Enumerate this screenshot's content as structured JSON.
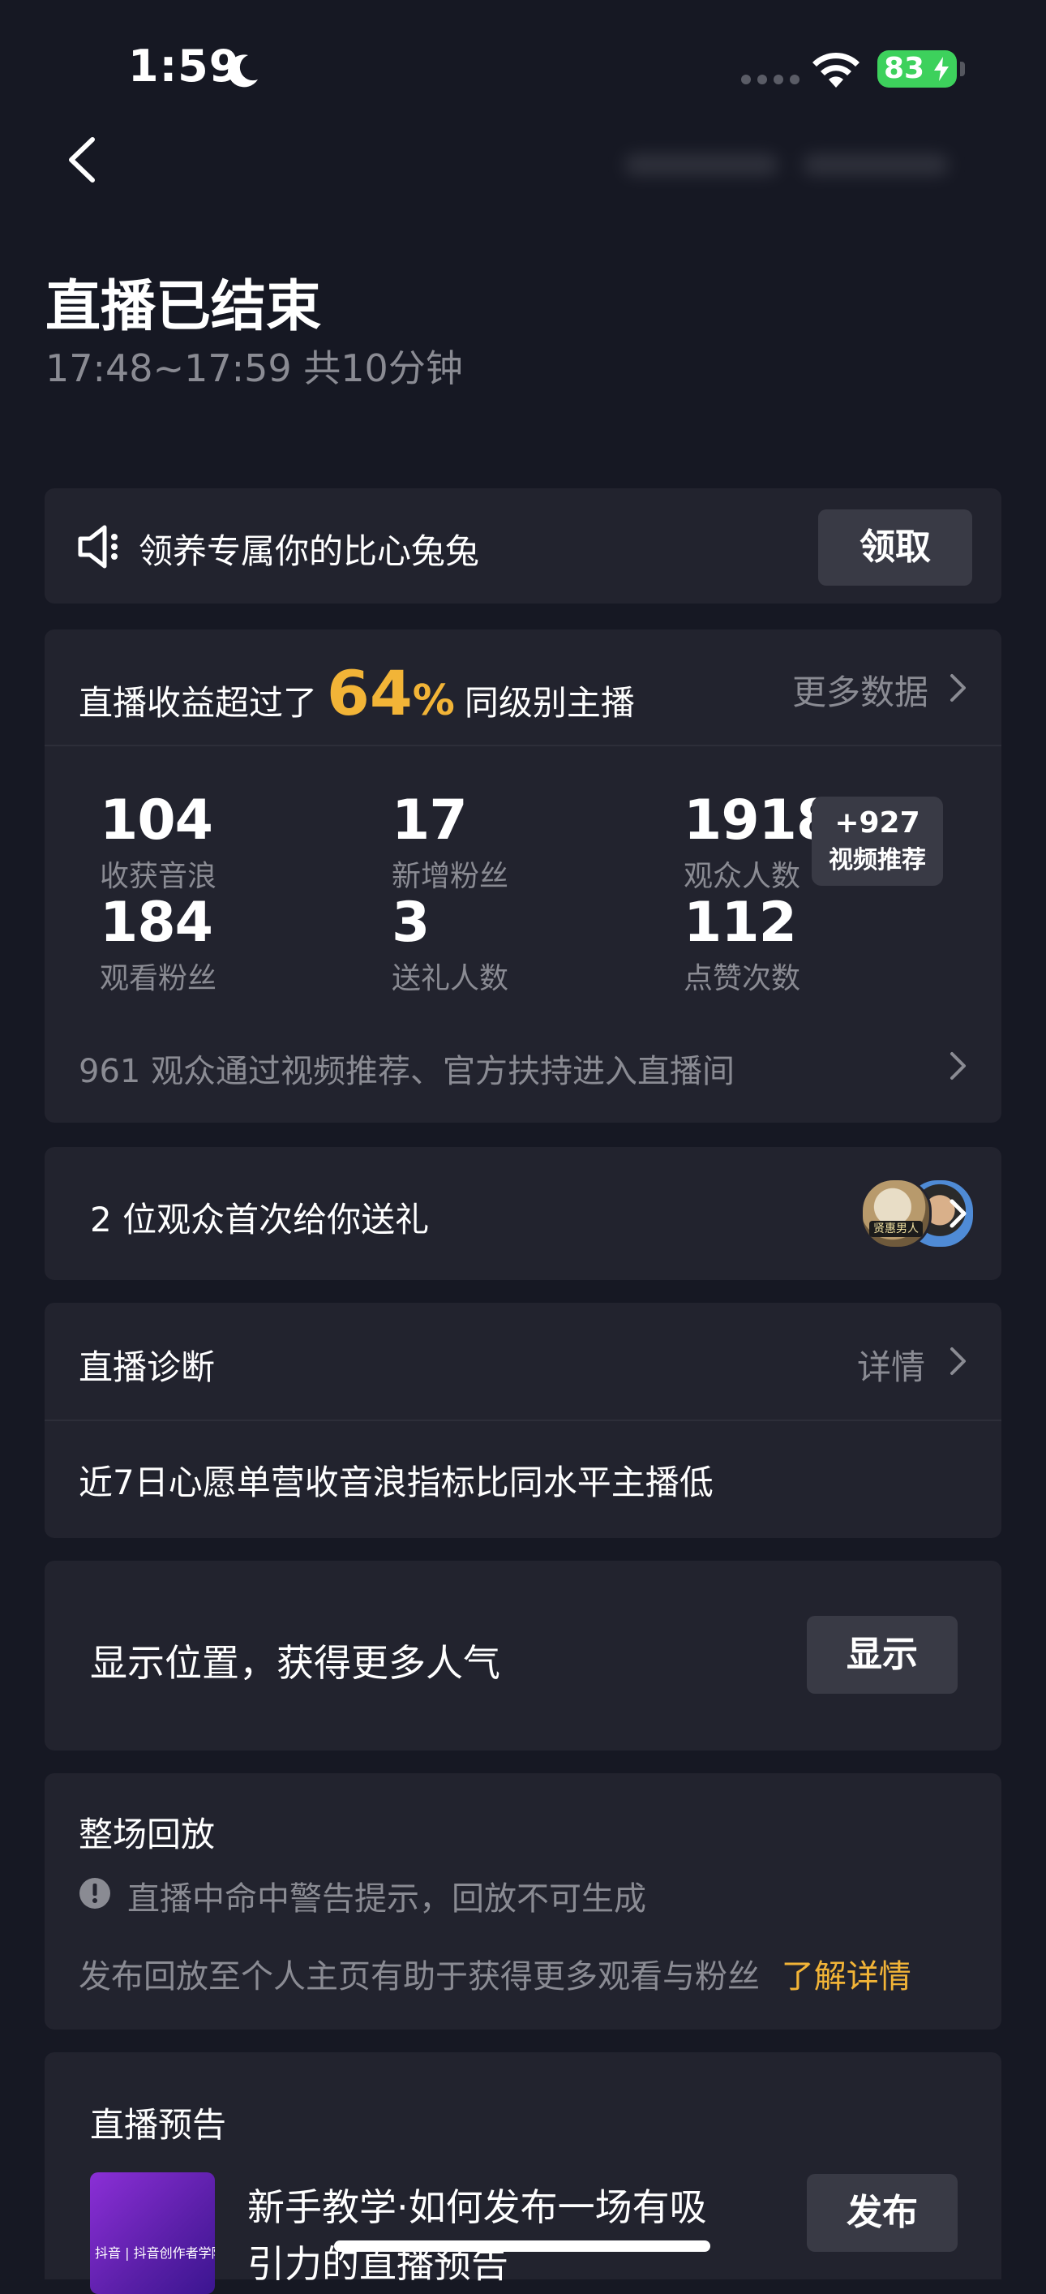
{
  "status_bar": {
    "time": "1:59",
    "battery": "83"
  },
  "header": {
    "title": "直播已结束",
    "subtitle": "17:48~17:59 共10分钟"
  },
  "promo": {
    "text": "领养专属你的比心兔兔",
    "button": "领取"
  },
  "earnings": {
    "prefix": "直播收益超过了",
    "percent": "64",
    "percent_sign": "%",
    "suffix": "同级别主播",
    "more_label": "更多数据",
    "stats": [
      {
        "value": "104",
        "label": "收获音浪"
      },
      {
        "value": "17",
        "label": "新增粉丝"
      },
      {
        "value": "1918",
        "label": "观众人数"
      },
      {
        "value": "184",
        "label": "观看粉丝"
      },
      {
        "value": "3",
        "label": "送礼人数"
      },
      {
        "value": "112",
        "label": "点赞次数"
      }
    ],
    "badge": {
      "value": "+927",
      "label": "视频推荐"
    },
    "footnote": "961 观众通过视频推荐、官方扶持进入直播间"
  },
  "gifts": {
    "text": "2 位观众首次给你送礼",
    "avatar1_label": "贤惠男人"
  },
  "diagnosis": {
    "title": "直播诊断",
    "detail": "详情",
    "message": "近7日心愿单营收音浪指标比同水平主播低"
  },
  "location": {
    "text": "显示位置，获得更多人气",
    "button": "显示"
  },
  "replay": {
    "title": "整场回放",
    "warning": "直播中命中警告提示，回放不可生成",
    "desc": "发布回放至个人主页有助于获得更多观看与粉丝",
    "link": "了解详情"
  },
  "preview": {
    "title": "直播预告",
    "line1": "新手教学·如何发布一场有吸",
    "line2": "引力的直播预告",
    "button": "发布",
    "thumb_label": "抖音 | 抖音创作者学院"
  },
  "colors": {
    "accent": "#f2b437",
    "background": "#161823",
    "card": "#22232e"
  }
}
